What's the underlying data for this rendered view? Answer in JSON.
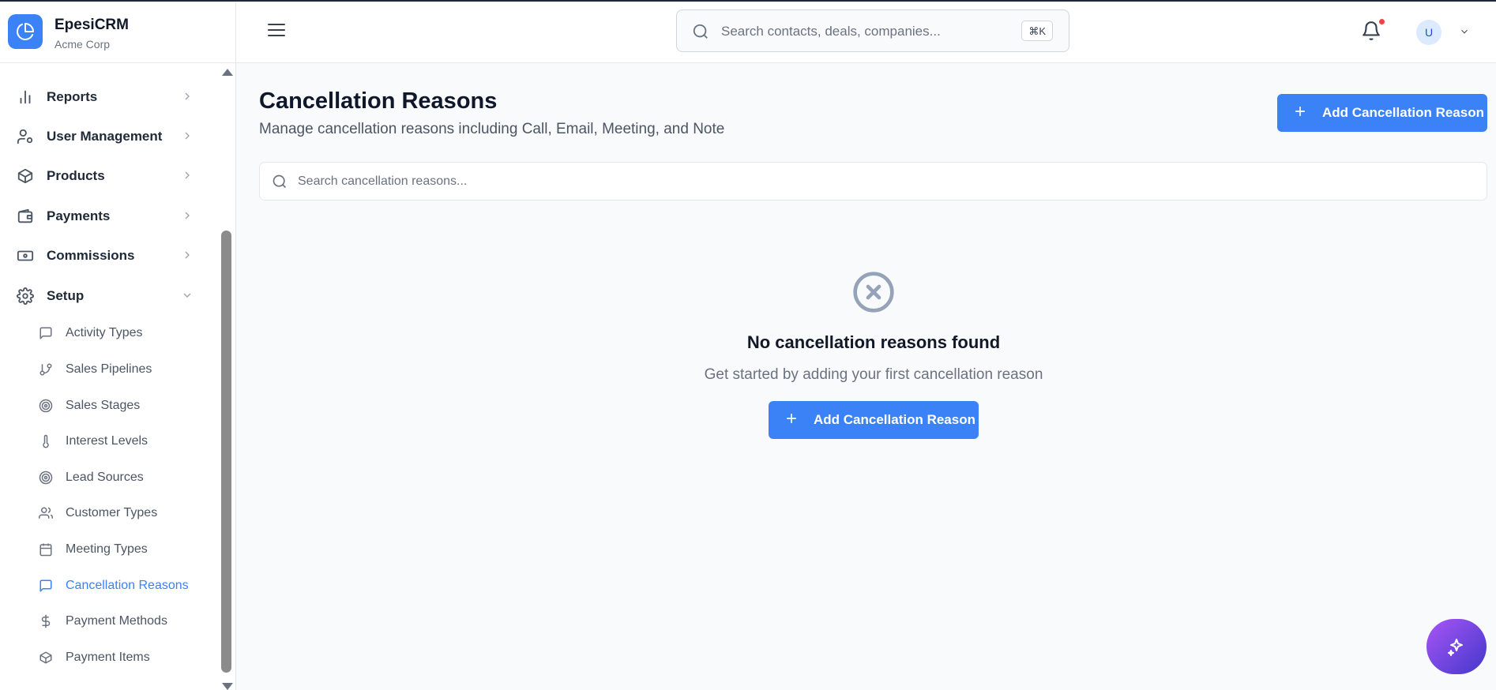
{
  "brand": {
    "name": "EpesiCRM",
    "org": "Acme Corp"
  },
  "sidebar": {
    "items": [
      {
        "label": "Reports",
        "icon": "bar-chart-icon"
      },
      {
        "label": "User Management",
        "icon": "user-cog-icon"
      },
      {
        "label": "Products",
        "icon": "package-icon"
      },
      {
        "label": "Payments",
        "icon": "wallet-icon"
      },
      {
        "label": "Commissions",
        "icon": "banknote-icon"
      },
      {
        "label": "Setup",
        "icon": "gear-icon",
        "expanded": true
      }
    ],
    "setup_items": [
      {
        "label": "Activity Types",
        "icon": "message-square-icon"
      },
      {
        "label": "Sales Pipelines",
        "icon": "git-branch-icon"
      },
      {
        "label": "Sales Stages",
        "icon": "target-icon"
      },
      {
        "label": "Interest Levels",
        "icon": "thermometer-icon"
      },
      {
        "label": "Lead Sources",
        "icon": "target-icon"
      },
      {
        "label": "Customer Types",
        "icon": "users-icon"
      },
      {
        "label": "Meeting Types",
        "icon": "calendar-icon"
      },
      {
        "label": "Cancellation Reasons",
        "icon": "message-square-icon",
        "active": true
      },
      {
        "label": "Payment Methods",
        "icon": "dollar-icon"
      },
      {
        "label": "Payment Items",
        "icon": "package-icon"
      }
    ]
  },
  "header": {
    "search_placeholder": "Search contacts, deals, companies...",
    "shortcut": "⌘K",
    "avatar_initial": "U"
  },
  "main": {
    "title": "Cancellation Reasons",
    "subtitle": "Manage cancellation reasons including Call, Email, Meeting, and Note",
    "add_button": "Add Cancellation Reason",
    "search_placeholder": "Search cancellation reasons...",
    "empty": {
      "title": "No cancellation reasons found",
      "subtitle": "Get started by adding your first cancellation reason",
      "button": "Add Cancellation Reason"
    }
  },
  "colors": {
    "accent": "#3b82f6",
    "active_text": "#3b82f6",
    "notification_dot": "#ef4444",
    "fab_gradient_start": "#a855f7",
    "fab_gradient_end": "#4338ca"
  }
}
